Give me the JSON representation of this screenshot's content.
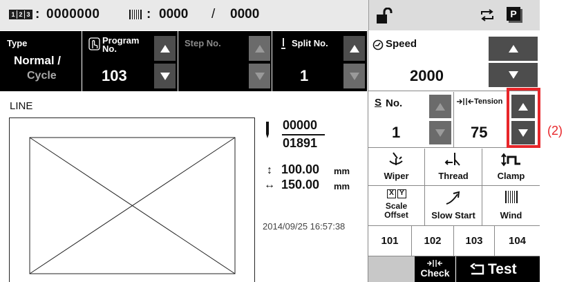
{
  "header": {
    "counter_icon": "123-counter-icon",
    "counter_value": "0000000",
    "bobbin_icon": "bobbin-icon",
    "bobbin_value": "0000",
    "separator": "/",
    "bobbin_total": "0000"
  },
  "top_right": {
    "lock_icon": "unlock-icon",
    "repeat_icon": "repeat-icon",
    "p_icon": "P"
  },
  "type_panel": {
    "label": "Type",
    "value_line1": "Normal /",
    "value_line2": "Cycle"
  },
  "program_panel": {
    "label_line1": "Program",
    "label_line2": "No.",
    "value": "103"
  },
  "step_panel": {
    "label": "Step No.",
    "value": ""
  },
  "split_panel": {
    "label": "Split No.",
    "value": "1"
  },
  "line_label": "LINE",
  "pattern_info": {
    "stitch_count": "00000",
    "stitch_total": "01891",
    "height": "100.00",
    "height_unit": "mm",
    "width": "150.00",
    "width_unit": "mm",
    "timestamp": "2014/09/25 16:57:38"
  },
  "speed": {
    "label": "Speed",
    "value": "2000"
  },
  "s_no": {
    "label_s": "S",
    "label": "No.",
    "value": "1"
  },
  "tension": {
    "label": "Tension",
    "value": "75"
  },
  "callout": "(2)",
  "functions": {
    "wiper": "Wiper",
    "thread": "Thread",
    "clamp": "Clamp",
    "scale_offset_line1": "Scale",
    "scale_offset_line2": "Offset",
    "slow_start": "Slow Start",
    "wind": "Wind"
  },
  "programs": [
    "101",
    "102",
    "103",
    "104"
  ],
  "bottom": {
    "check": "Check",
    "test": "Test"
  },
  "colors": {
    "highlight": "#e8262a",
    "panel": "#000000",
    "button": "#4d4d4d",
    "bar": "#dcdcdc"
  }
}
